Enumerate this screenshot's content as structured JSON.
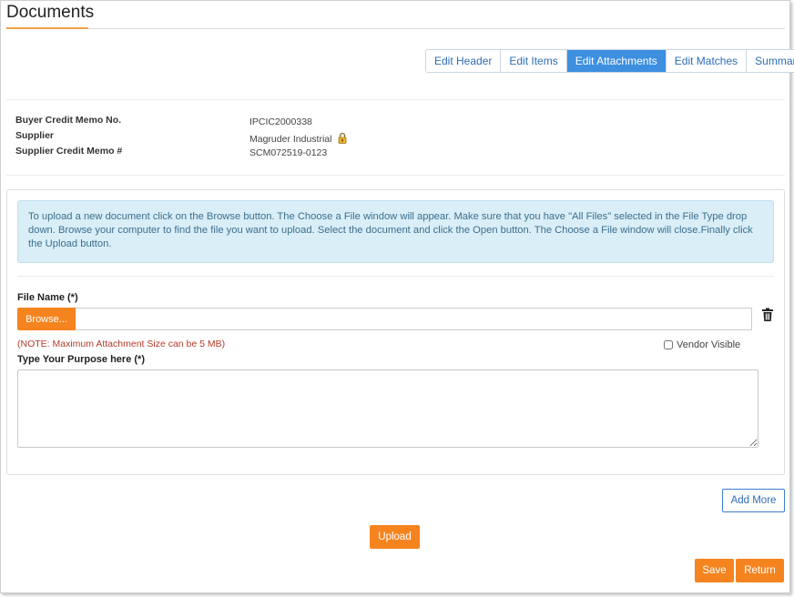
{
  "page": {
    "title": "Documents"
  },
  "tabs": [
    {
      "label": "Edit Header",
      "active": false
    },
    {
      "label": "Edit Items",
      "active": false
    },
    {
      "label": "Edit Attachments",
      "active": true
    },
    {
      "label": "Edit Matches",
      "active": false
    },
    {
      "label": "Summary",
      "active": false
    }
  ],
  "info": {
    "buyer_credit_memo_label": "Buyer Credit Memo No.",
    "buyer_credit_memo_value": "IPCIC2000338",
    "supplier_label": "Supplier",
    "supplier_value": "Magruder Industrial",
    "supplier_credit_memo_label": "Supplier Credit Memo #",
    "supplier_credit_memo_value": "SCM072519-0123"
  },
  "upload_form": {
    "instructions": "To upload a new document click on the Browse button. The Choose a File window will appear. Make sure that you have \"All Files\" selected in the File Type drop down. Browse your computer to find the file you want to upload. Select the document and click the Open button. The Choose a File window will close.Finally click the Upload button.",
    "file_name_label": "File Name (*)",
    "browse_label": "Browse...",
    "file_value": "",
    "note": "(NOTE: Maximum Attachment Size can be 5 MB)",
    "vendor_visible_label": "Vendor Visible",
    "vendor_visible_checked": false,
    "purpose_label": "Type Your Purpose here (*)",
    "purpose_value": ""
  },
  "actions": {
    "add_more": "Add More",
    "upload": "Upload",
    "save": "Save",
    "return": "Return"
  },
  "colors": {
    "accent_orange": "#f5841f",
    "tab_active": "#3d8fe0",
    "alert_bg": "#d9eef7",
    "note_red": "#b53a2a"
  }
}
